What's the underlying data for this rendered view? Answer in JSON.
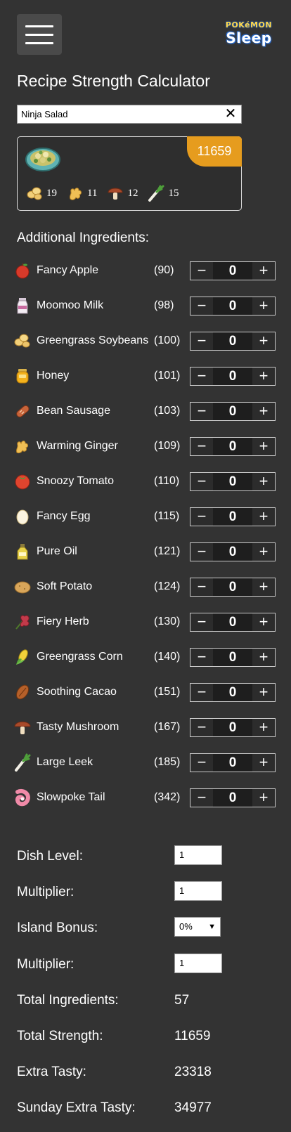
{
  "header": {
    "menu_icon": "hamburger-icon",
    "logo_top": "POKéMON",
    "logo_bottom": "Sleep"
  },
  "title": "Recipe Strength Calculator",
  "search": {
    "value": "Ninja Salad"
  },
  "recipe_card": {
    "strength": "11659",
    "dish_icon": "ninja-salad-icon",
    "ingredients": [
      {
        "icon": "greengrass-soybeans-icon",
        "count": "19"
      },
      {
        "icon": "warming-ginger-icon",
        "count": "11"
      },
      {
        "icon": "tasty-mushroom-icon",
        "count": "12"
      },
      {
        "icon": "large-leek-icon",
        "count": "15"
      }
    ]
  },
  "additional_title": "Additional Ingredients:",
  "ingredients": [
    {
      "name": "Fancy Apple",
      "power": "(90)",
      "qty": "0",
      "icon": "apple-icon"
    },
    {
      "name": "Moomoo Milk",
      "power": "(98)",
      "qty": "0",
      "icon": "milk-icon"
    },
    {
      "name": "Greengrass Soybeans",
      "power": "(100)",
      "qty": "0",
      "icon": "soybeans-icon"
    },
    {
      "name": "Honey",
      "power": "(101)",
      "qty": "0",
      "icon": "honey-icon"
    },
    {
      "name": "Bean Sausage",
      "power": "(103)",
      "qty": "0",
      "icon": "sausage-icon"
    },
    {
      "name": "Warming Ginger",
      "power": "(109)",
      "qty": "0",
      "icon": "ginger-icon"
    },
    {
      "name": "Snoozy Tomato",
      "power": "(110)",
      "qty": "0",
      "icon": "tomato-icon"
    },
    {
      "name": "Fancy Egg",
      "power": "(115)",
      "qty": "0",
      "icon": "egg-icon"
    },
    {
      "name": "Pure Oil",
      "power": "(121)",
      "qty": "0",
      "icon": "oil-icon"
    },
    {
      "name": "Soft Potato",
      "power": "(124)",
      "qty": "0",
      "icon": "potato-icon"
    },
    {
      "name": "Fiery Herb",
      "power": "(130)",
      "qty": "0",
      "icon": "herb-icon"
    },
    {
      "name": "Greengrass Corn",
      "power": "(140)",
      "qty": "0",
      "icon": "corn-icon"
    },
    {
      "name": "Soothing Cacao",
      "power": "(151)",
      "qty": "0",
      "icon": "cacao-icon"
    },
    {
      "name": "Tasty Mushroom",
      "power": "(167)",
      "qty": "0",
      "icon": "mushroom-icon"
    },
    {
      "name": "Large Leek",
      "power": "(185)",
      "qty": "0",
      "icon": "leek-icon"
    },
    {
      "name": "Slowpoke Tail",
      "power": "(342)",
      "qty": "0",
      "icon": "slowpoke-tail-icon"
    }
  ],
  "stepper": {
    "minus": "−",
    "plus": "+"
  },
  "form": {
    "dish_level_label": "Dish Level:",
    "dish_level_value": "1",
    "multiplier_label": "Multiplier:",
    "multiplier_value": "1",
    "island_bonus_label": "Island Bonus:",
    "island_bonus_value": "0%",
    "multiplier2_label": "Multiplier:",
    "multiplier2_value": "1",
    "total_ingredients_label": "Total Ingredients:",
    "total_ingredients_value": "57",
    "total_strength_label": "Total Strength:",
    "total_strength_value": "11659",
    "extra_tasty_label": "Extra Tasty:",
    "extra_tasty_value": "23318",
    "sunday_extra_tasty_label": "Sunday Extra Tasty:",
    "sunday_extra_tasty_value": "34977"
  },
  "colors": {
    "background": "#333333",
    "accent": "#e69c1e",
    "text": "#ffffff"
  }
}
